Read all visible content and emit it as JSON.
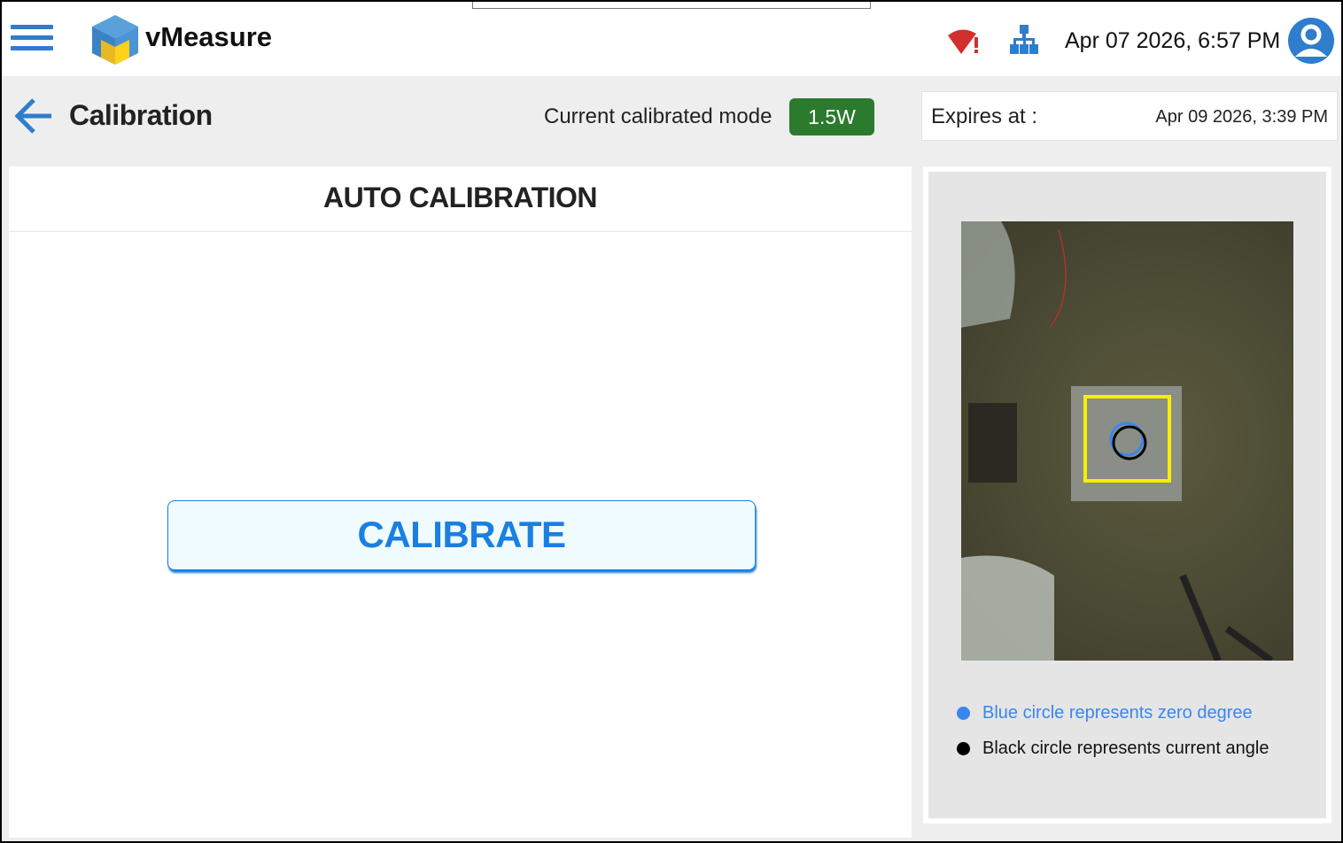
{
  "header": {
    "app_name": "vMeasure",
    "datetime": "Apr 07 2026, 6:57 PM",
    "colors": {
      "accent": "#2f7dcc",
      "wifi_alert": "#d32f2f"
    }
  },
  "subheader": {
    "title": "Calibration",
    "mode_label": "Current calibrated mode",
    "mode_value": "1.5W",
    "mode_color": "#2c7a2e",
    "expires_label": "Expires at :",
    "expires_value": "Apr 09 2026, 3:39 PM"
  },
  "main": {
    "panel_title": "AUTO CALIBRATION",
    "calibrate_label": "CALIBRATE"
  },
  "preview": {
    "legend": [
      {
        "text": "Blue circle represents zero degree",
        "color": "#3a86f0"
      },
      {
        "text": "Black circle represents current angle",
        "color": "#000000"
      }
    ]
  }
}
